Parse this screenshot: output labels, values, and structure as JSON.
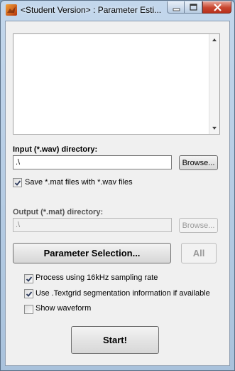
{
  "window": {
    "title": "<Student Version> : Parameter Esti...",
    "icons": {
      "app": "matlab-icon",
      "minimize": "minimize-icon",
      "maximize": "maximize-icon",
      "close": "close-icon"
    }
  },
  "listbox": {
    "items": []
  },
  "input": {
    "label": "Input (*.wav) directory:",
    "value": ".\\",
    "browse_label": "Browse..."
  },
  "save_mat": {
    "label": "Save *.mat files with *.wav files",
    "checked": true
  },
  "output": {
    "label": "Output (*.mat) directory:",
    "value": ".\\",
    "browse_label": "Browse...",
    "enabled": false
  },
  "param_button": {
    "label": "Parameter Selection..."
  },
  "all_button": {
    "label": "All",
    "enabled": false
  },
  "options": [
    {
      "label": "Process using 16kHz sampling rate",
      "checked": true
    },
    {
      "label": "Use .Textgrid segmentation information if available",
      "checked": true
    },
    {
      "label": "Show waveform",
      "checked": false
    }
  ],
  "start_button": {
    "label": "Start!"
  },
  "colors": {
    "window_frame": "#a9c2dc",
    "close_button": "#c8452f",
    "panel": "#f0f0f0"
  }
}
